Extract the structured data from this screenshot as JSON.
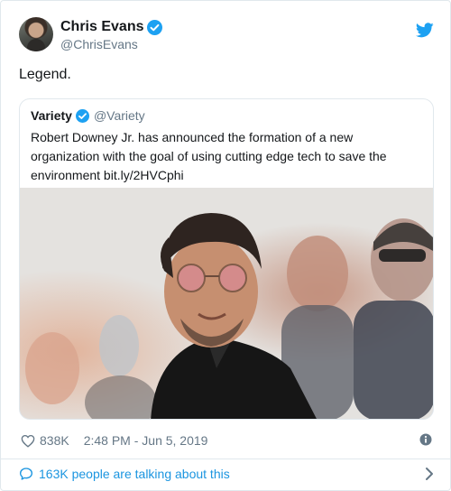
{
  "author": {
    "name": "Chris Evans",
    "handle": "@ChrisEvans",
    "verified": true
  },
  "tweet": {
    "text": "Legend."
  },
  "quoted": {
    "name": "Variety",
    "handle": "@Variety",
    "verified": true,
    "text": "Robert Downey Jr. has announced the formation of a new organization with the goal of using cutting edge tech to save the environment bit.ly/2HVCphi"
  },
  "meta": {
    "likes": "838K",
    "timestamp": "2:48 PM - Jun 5, 2019"
  },
  "footer": {
    "talking": "163K people are talking about this"
  },
  "icons": {
    "brand": "twitter-bird-icon",
    "like": "heart-icon",
    "info": "info-icon",
    "reply": "speech-bubble-icon",
    "more": "chevron-right-icon"
  },
  "colors": {
    "accent": "#1da1f2",
    "link": "#1b95e0",
    "muted": "#657786",
    "text": "#14171a",
    "border": "#e1e8ed"
  }
}
